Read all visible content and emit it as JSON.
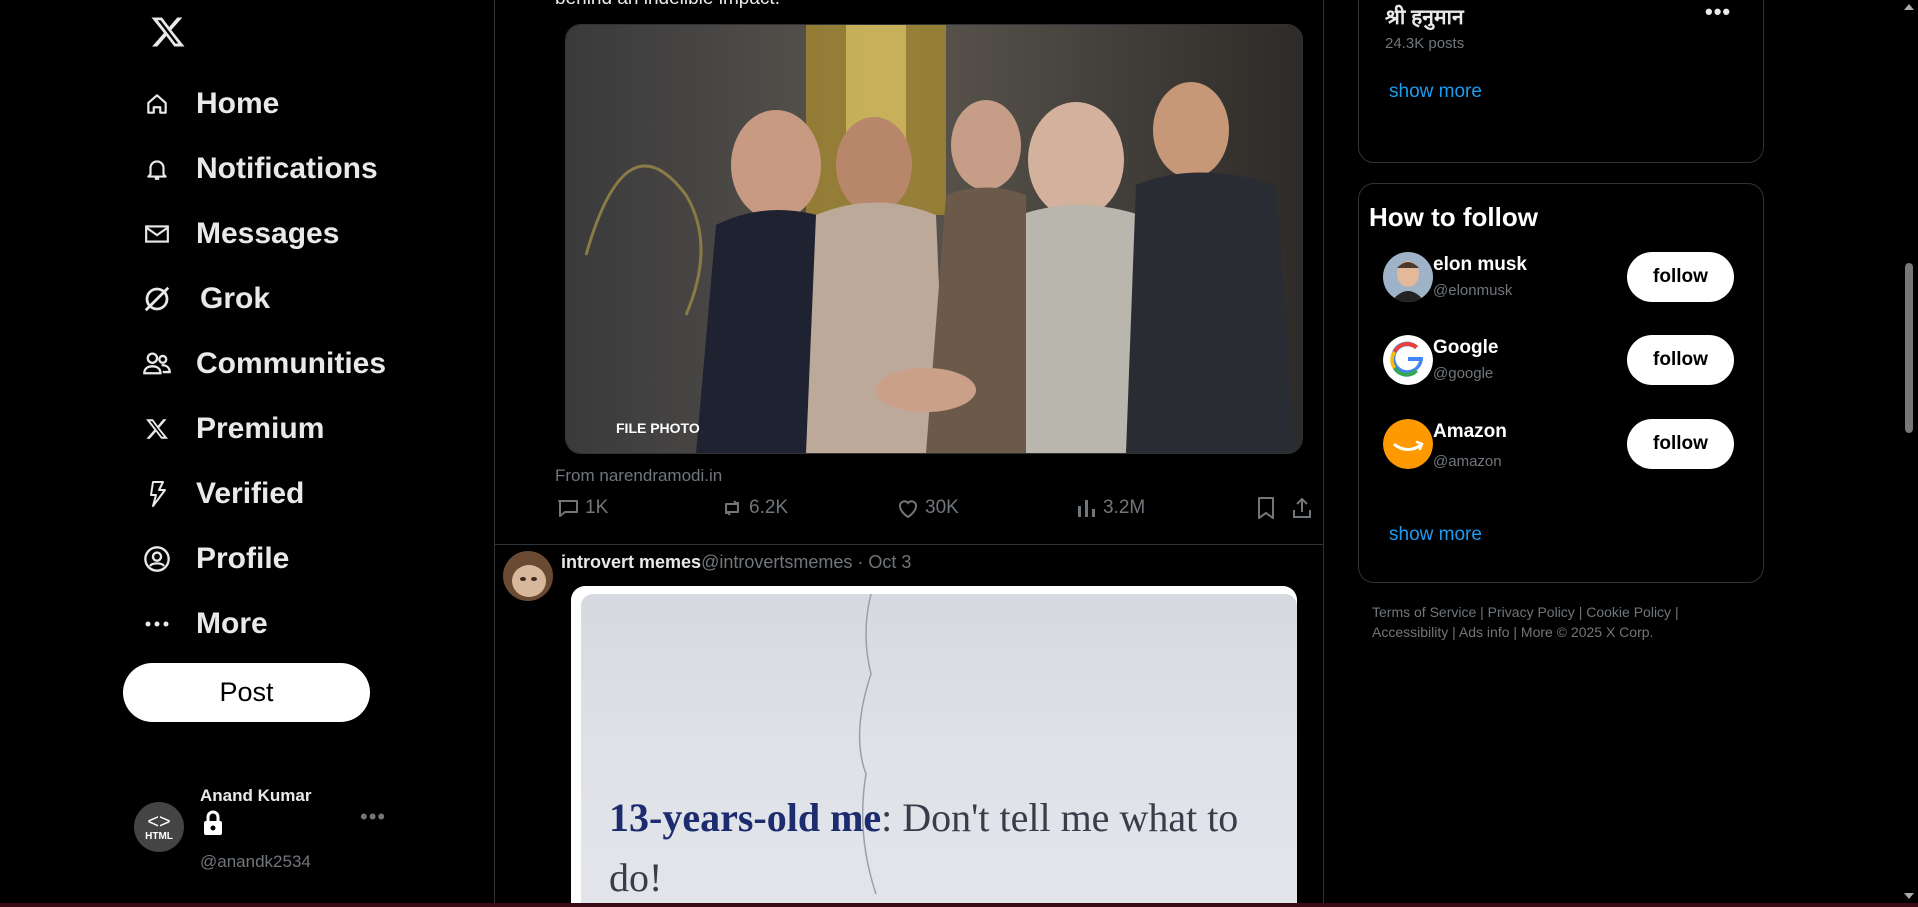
{
  "sidebar": {
    "logo": "x-logo",
    "items": [
      {
        "label": "Home",
        "icon": "home-icon"
      },
      {
        "label": "Notifications",
        "icon": "bell-icon"
      },
      {
        "label": "Messages",
        "icon": "envelope-icon"
      },
      {
        "label": "Grok",
        "icon": "grok-icon"
      },
      {
        "label": "Communities",
        "icon": "people-icon"
      },
      {
        "label": "Premium",
        "icon": "x-icon"
      },
      {
        "label": "Verified",
        "icon": "lightning-icon"
      },
      {
        "label": "Profile",
        "icon": "person-icon"
      },
      {
        "label": "More",
        "icon": "more-dots-icon"
      }
    ],
    "post_label": "Post",
    "account": {
      "name": "Anand Kumar",
      "handle": "@anandk2534",
      "avatar_text": "HTML"
    }
  },
  "feed": {
    "prev_tweet_text": "behind an indelible impact.",
    "prev_tweet_media_caption": "FILE PHOTO",
    "prev_tweet_source": "From narendramodi.in",
    "prev_tweet_stats": {
      "replies": "1K",
      "reposts": "6.2K",
      "likes": "30K",
      "views": "3.2M"
    },
    "tweet2": {
      "name": "introvert memes",
      "handle": "@introvertsmemes",
      "date": "· Oct 3",
      "meme_bold": "13-years-old me",
      "meme_rest": ": Don't tell me what to do!"
    }
  },
  "right": {
    "trend": {
      "name": "श्री हनुमान",
      "count": "24.3K posts"
    },
    "show_more_1": "show more",
    "who_to_follow_title": "How to follow",
    "follows": [
      {
        "name": "elon musk",
        "handle": "@elonmusk",
        "button": "follow"
      },
      {
        "name": "Google",
        "handle": "@google",
        "button": "follow"
      },
      {
        "name": "Amazon",
        "handle": "@amazon",
        "button": "follow"
      }
    ],
    "show_more_2": "show more",
    "footer_links": [
      "Terms of Service",
      "Privacy Policy",
      "Cookie Policy",
      "Accessibility",
      "Ads info",
      "More"
    ],
    "copyright": "© 2025 X Corp."
  },
  "colors": {
    "background": "#000000",
    "link": "#1d9bf0",
    "muted": "#71767b",
    "text": "#e7e9ea"
  }
}
